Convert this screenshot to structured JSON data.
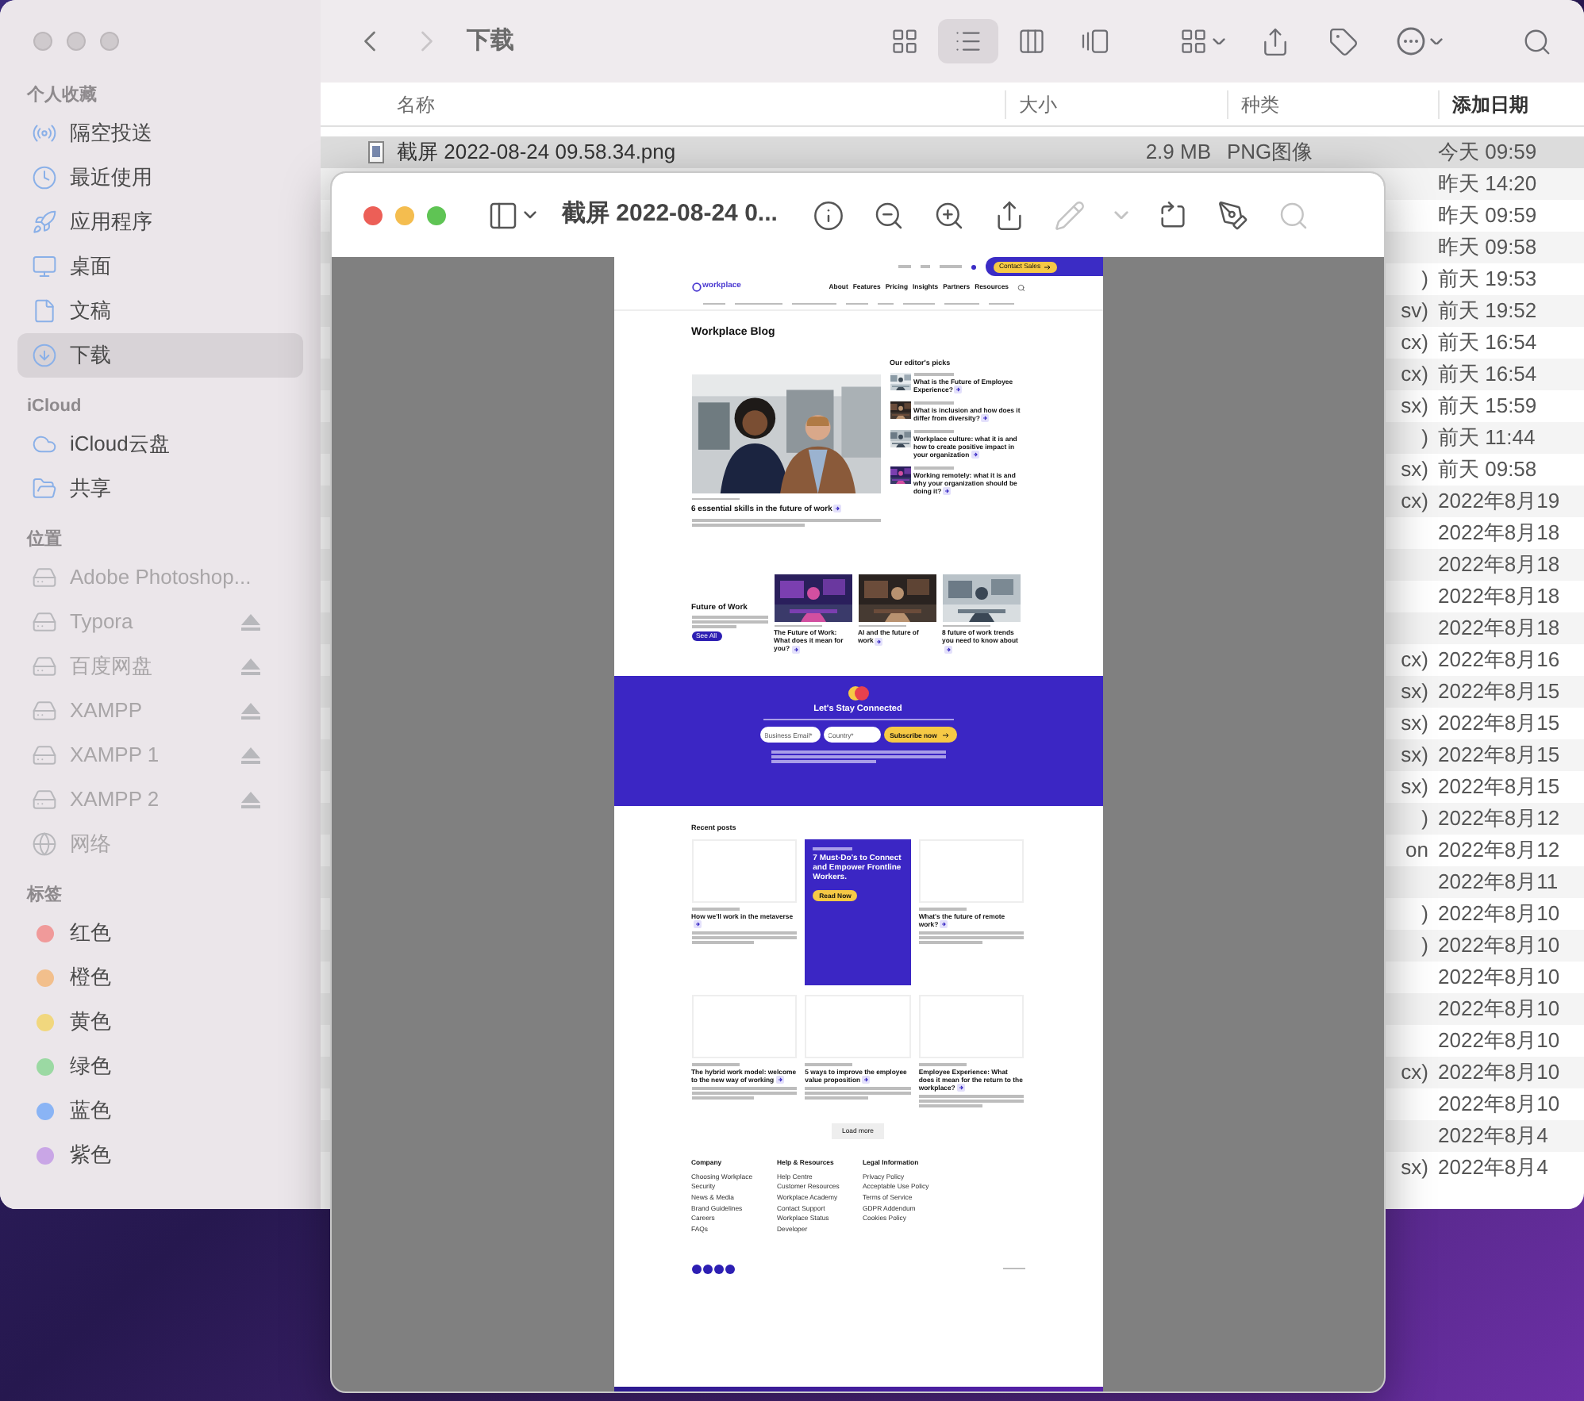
{
  "finder": {
    "title": "下载",
    "view_modes": [
      {
        "kind": "icons",
        "selected": false
      },
      {
        "kind": "list",
        "selected": true
      },
      {
        "kind": "columns",
        "selected": false
      },
      {
        "kind": "gallery",
        "selected": false
      }
    ],
    "sidebar": [
      {
        "heading": "个人收藏",
        "items": [
          {
            "label": "隔空投送",
            "kind": "airdrop",
            "selected": false
          },
          {
            "label": "最近使用",
            "kind": "recent",
            "selected": false
          },
          {
            "label": "应用程序",
            "kind": "apps",
            "selected": false
          },
          {
            "label": "桌面",
            "kind": "desktop",
            "selected": false
          },
          {
            "label": "文稿",
            "kind": "docs",
            "selected": false
          },
          {
            "label": "下载",
            "kind": "downloads",
            "selected": true
          }
        ]
      },
      {
        "heading": "iCloud",
        "items": [
          {
            "label": "iCloud云盘",
            "kind": "cloud",
            "selected": false
          },
          {
            "label": "共享",
            "kind": "shared",
            "selected": false
          }
        ]
      },
      {
        "heading": "位置",
        "items": [
          {
            "label": "Adobe Photoshop...",
            "kind": "disk",
            "selected": false
          },
          {
            "label": "Typora",
            "kind": "disk",
            "selected": false
          },
          {
            "label": "百度网盘",
            "kind": "disk",
            "selected": false
          },
          {
            "label": "XAMPP",
            "kind": "disk",
            "selected": false
          },
          {
            "label": "XAMPP 1",
            "kind": "disk",
            "selected": false
          },
          {
            "label": "XAMPP 2",
            "kind": "disk",
            "selected": false
          },
          {
            "label": "网络",
            "kind": "network",
            "selected": false
          }
        ]
      },
      {
        "heading": "标签",
        "items": [
          {
            "label": "红色",
            "kind": "tag",
            "color": "#f09a9a",
            "selected": false
          },
          {
            "label": "橙色",
            "kind": "tag",
            "color": "#f2bf8c",
            "selected": false
          },
          {
            "label": "黄色",
            "kind": "tag",
            "color": "#f1d77e",
            "selected": false
          },
          {
            "label": "绿色",
            "kind": "tag",
            "color": "#9bd9a3",
            "selected": false
          },
          {
            "label": "蓝色",
            "kind": "tag",
            "color": "#8ab4f5",
            "selected": false
          },
          {
            "label": "紫色",
            "kind": "tag",
            "color": "#c9a6e6",
            "selected": false
          }
        ]
      }
    ],
    "columns": [
      {
        "label": "名称",
        "sorted": false
      },
      {
        "label": "大小",
        "sorted": false
      },
      {
        "label": "种类",
        "sorted": false
      },
      {
        "label": "添加日期",
        "sorted": true
      }
    ],
    "rows": [
      {
        "name": "截屏 2022-08-24 09.58.34.png",
        "size": "2.9 MB",
        "type": "PNG图像",
        "added": "今天 09:59",
        "selected": true
      },
      {
        "added": "昨天 14:20",
        "selected": false
      },
      {
        "added": "昨天 09:59",
        "selected": false
      },
      {
        "added": "昨天 09:58",
        "selected": false
      },
      {
        "type": ")",
        "added": "前天 19:53",
        "selected": false
      },
      {
        "type": "sv)",
        "added": "前天 19:52",
        "selected": false
      },
      {
        "type": "cx)",
        "added": "前天 16:54",
        "selected": false
      },
      {
        "type": "cx)",
        "added": "前天 16:54",
        "selected": false
      },
      {
        "type": "sx)",
        "added": "前天 15:59",
        "selected": false
      },
      {
        "type": ")",
        "added": "前天 11:44",
        "selected": false
      },
      {
        "type": "sx)",
        "added": "前天 09:58",
        "selected": false
      },
      {
        "type": "cx)",
        "added": "2022年8月19",
        "selected": false
      },
      {
        "added": "2022年8月18",
        "selected": false
      },
      {
        "added": "2022年8月18",
        "selected": false
      },
      {
        "added": "2022年8月18",
        "selected": false
      },
      {
        "added": "2022年8月18",
        "selected": false
      },
      {
        "type": "cx)",
        "added": "2022年8月16",
        "selected": false
      },
      {
        "type": "sx)",
        "added": "2022年8月15",
        "selected": false
      },
      {
        "type": "sx)",
        "added": "2022年8月15",
        "selected": false
      },
      {
        "type": "sx)",
        "added": "2022年8月15",
        "selected": false
      },
      {
        "type": "sx)",
        "added": "2022年8月15",
        "selected": false
      },
      {
        "type": ")",
        "added": "2022年8月12",
        "selected": false
      },
      {
        "type": "on",
        "added": "2022年8月12",
        "selected": false
      },
      {
        "added": "2022年8月11",
        "selected": false
      },
      {
        "type": ")",
        "added": "2022年8月10",
        "selected": false
      },
      {
        "type": ")",
        "added": "2022年8月10",
        "selected": false
      },
      {
        "added": "2022年8月10",
        "selected": false
      },
      {
        "added": "2022年8月10",
        "selected": false
      },
      {
        "added": "2022年8月10",
        "selected": false
      },
      {
        "type": "cx)",
        "added": "2022年8月10",
        "selected": false
      },
      {
        "added": "2022年8月10",
        "selected": false
      },
      {
        "added": "2022年8月4",
        "selected": false
      },
      {
        "type": "sx)",
        "added": "2022年8月4",
        "selected": false
      }
    ]
  },
  "preview": {
    "title": "截屏 2022-08-24 0...",
    "tools": [
      {
        "kind": "info",
        "disabled": false
      },
      {
        "kind": "zoom-out",
        "disabled": false
      },
      {
        "kind": "zoom-in",
        "disabled": false
      },
      {
        "kind": "share",
        "disabled": false
      },
      {
        "kind": "pencil",
        "disabled": true
      },
      {
        "kind": "caret",
        "disabled": true
      },
      {
        "kind": "rotate",
        "disabled": false
      },
      {
        "kind": "markup",
        "disabled": false
      },
      {
        "kind": "search",
        "disabled": true
      }
    ],
    "page": {
      "contact_button": "Contact Sales",
      "logo": "workplace",
      "nav": [
        "About",
        "Features",
        "Pricing",
        "Insights",
        "Partners",
        "Resources"
      ],
      "heading": "Workplace Blog",
      "featured": {
        "title": "6 essential skills in the future of work"
      },
      "picks_heading": "Our editor's picks",
      "picks": [
        "What is the Future of Employee Experience?",
        "What is inclusion and how does it differ from diversity?",
        "Workplace culture: what it is and how to create positive impact in your organization",
        "Working remotely: what it is and why your organization should be doing it?"
      ],
      "section": {
        "title": "Future of Work",
        "button": "See All",
        "cards": [
          "The Future of Work: What does it mean for you?",
          "AI and the future of work",
          "8 future of work trends you need to know about"
        ]
      },
      "newsletter": {
        "title": "Let's Stay Connected",
        "email_placeholder": "Business Email*",
        "country_placeholder": "Country*",
        "button": "Subscribe now"
      },
      "recent_heading": "Recent posts",
      "recent": [
        {
          "kind": "post",
          "title": "How we'll work in the metaverse"
        },
        {
          "kind": "promo",
          "title": "7 Must-Do's to Connect and Empower Frontline Workers.",
          "button": "Read Now"
        },
        {
          "kind": "post",
          "title": "What's the future of remote work?"
        },
        {
          "kind": "post",
          "title": "The hybrid work model: welcome to the new way of working"
        },
        {
          "kind": "post",
          "title": "5 ways to improve the employee value proposition"
        },
        {
          "kind": "post",
          "title": "Employee Experience: What does it mean for the return to the workplace?"
        }
      ],
      "load_more": "Load more",
      "footer": [
        {
          "heading": "Company",
          "links": [
            "Choosing Workplace",
            "Security",
            "News & Media",
            "Brand Guidelines",
            "Careers",
            "FAQs"
          ]
        },
        {
          "heading": "Help & Resources",
          "links": [
            "Help Centre",
            "Customer Resources",
            "Workplace Academy",
            "Contact Support",
            "Workplace Status",
            "Developer"
          ]
        },
        {
          "heading": "Legal Information",
          "links": [
            "Privacy Policy",
            "Acceptable Use Policy",
            "Terms of Service",
            "GDPR Addendum",
            "Cookies Policy"
          ]
        }
      ]
    }
  }
}
